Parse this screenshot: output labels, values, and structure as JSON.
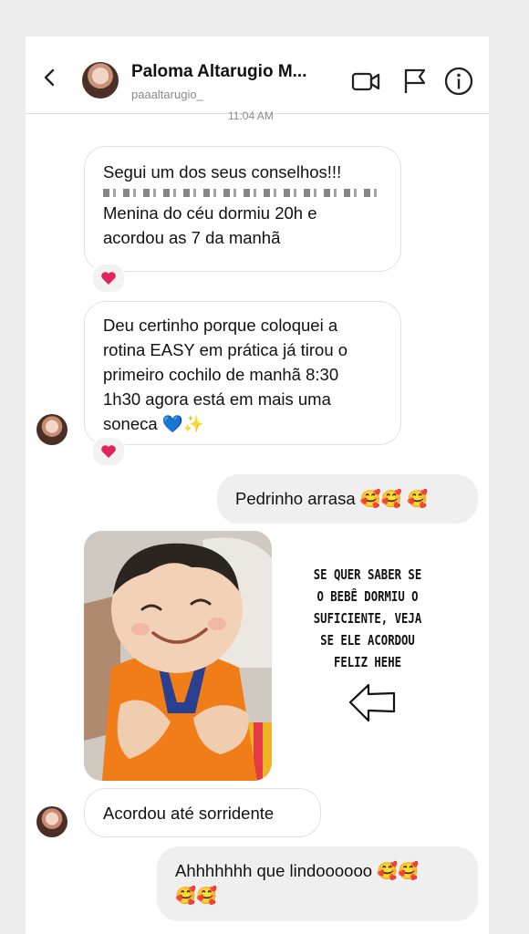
{
  "header": {
    "contact_name": "Paloma Altarugio M...",
    "contact_handle": "paaaltarugio_",
    "icons": [
      "back-icon",
      "video-call-icon",
      "flag-icon",
      "info-icon"
    ]
  },
  "timestamp": "11:04 AM",
  "messages": [
    {
      "direction": "incoming",
      "lines": [
        "Segui um dos seus conselhos!!!",
        "Menina do céu dormiu 20h e",
        "acordou as 7 da manhã"
      ],
      "reaction": "❤️"
    },
    {
      "direction": "incoming",
      "lines": [
        "Deu certinho porque coloquei a",
        "rotina EASY em prática já tirou o",
        "primeiro cochilo de manhã 8:30",
        "1h30 agora está em mais uma",
        "soneca 💙✨"
      ],
      "reaction": "❤️"
    },
    {
      "direction": "outgoing",
      "lines": [
        "Pedrinho arrasa 🥰🥰 🥰"
      ]
    },
    {
      "direction": "incoming",
      "type": "photo"
    },
    {
      "direction": "incoming",
      "lines": [
        "Acordou até sorridente"
      ]
    },
    {
      "direction": "outgoing",
      "lines": [
        "Ahhhhhhh que lindoooooo 🥰🥰",
        "🥰🥰"
      ]
    }
  ],
  "overlay": {
    "lines": [
      "SE QUER SABER SE",
      "O BEBÊ DORMIU O",
      "SUFICIENTE, VEJA",
      "SE ELE ACORDOU",
      "FELIZ HEHE"
    ],
    "arrow": "left-arrow-icon"
  },
  "colors": {
    "incoming_bg": "#ffffff",
    "outgoing_bg": "#efefef",
    "heart": "#e0245e",
    "blue_heart": "#2f7de1"
  }
}
